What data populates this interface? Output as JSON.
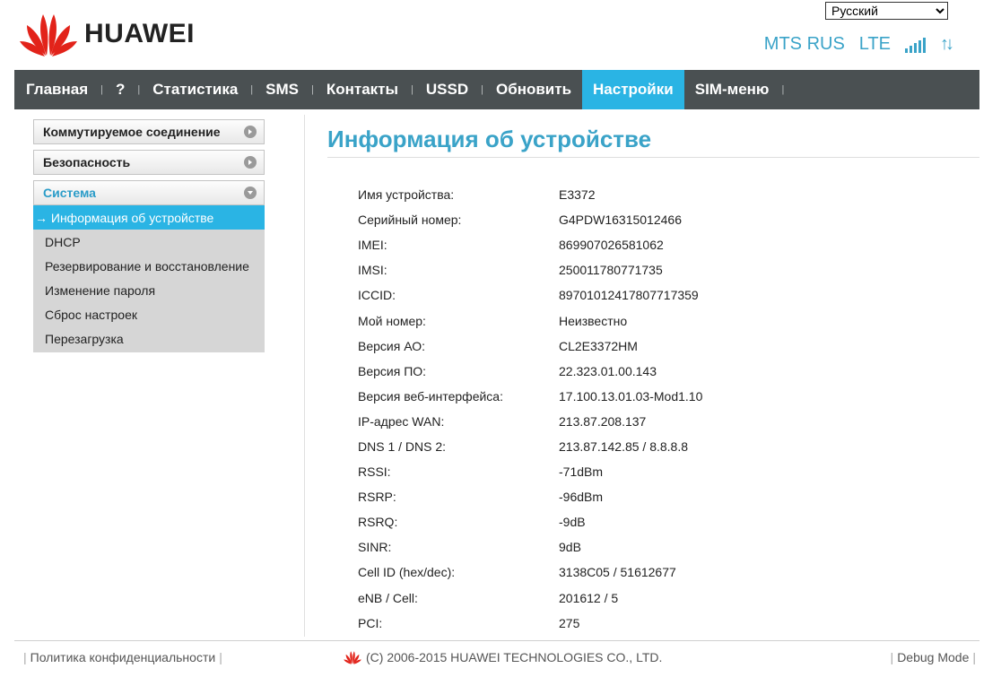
{
  "header": {
    "brand": "HUAWEI",
    "language": "Русский",
    "operator": "MTS RUS",
    "network": "LTE",
    "signal_bars": 5
  },
  "nav": {
    "items": [
      {
        "label": "Главная"
      },
      {
        "label": "?"
      },
      {
        "label": "Статистика"
      },
      {
        "label": "SMS"
      },
      {
        "label": "Контакты"
      },
      {
        "label": "USSD"
      },
      {
        "label": "Обновить"
      },
      {
        "label": "Настройки",
        "active": true
      },
      {
        "label": "SIM-меню"
      }
    ]
  },
  "sidebar": {
    "sections": [
      {
        "label": "Коммутируемое соединение"
      },
      {
        "label": "Безопасность"
      },
      {
        "label": "Система",
        "open": true
      }
    ],
    "items": [
      {
        "label": "→ Информация об устройстве",
        "active": true
      },
      {
        "label": "DHCP"
      },
      {
        "label": "Резервирование и восстановление"
      },
      {
        "label": "Изменение пароля"
      },
      {
        "label": "Сброс настроек"
      },
      {
        "label": "Перезагрузка"
      }
    ]
  },
  "main": {
    "title": "Информация об устройстве",
    "rows": [
      {
        "label": "Имя устройства:",
        "value": "E3372"
      },
      {
        "label": "Серийный номер:",
        "value": "G4PDW16315012466"
      },
      {
        "label": "IMEI:",
        "value": "869907026581062"
      },
      {
        "label": "IMSI:",
        "value": "250011780771735"
      },
      {
        "label": "ICCID:",
        "value": "89701012417807717359"
      },
      {
        "label": "Мой номер:",
        "value": "Неизвестно"
      },
      {
        "label": "Версия АО:",
        "value": "CL2E3372HM"
      },
      {
        "label": "Версия ПО:",
        "value": "22.323.01.00.143"
      },
      {
        "label": "Версия веб-интерфейса:",
        "value": "17.100.13.01.03-Mod1.10"
      },
      {
        "label": "IP-адрес WAN:",
        "value": "213.87.208.137"
      },
      {
        "label": "DNS 1 / DNS 2:",
        "value": "213.87.142.85 / 8.8.8.8"
      },
      {
        "label": "RSSI:",
        "value": "-71dBm"
      },
      {
        "label": "RSRP:",
        "value": "-96dBm"
      },
      {
        "label": "RSRQ:",
        "value": "-9dB"
      },
      {
        "label": "SINR:",
        "value": "9dB"
      },
      {
        "label": "Cell ID (hex/dec):",
        "value": "3138C05 / 51612677"
      },
      {
        "label": "eNB / Cell:",
        "value": "201612 / 5"
      },
      {
        "label": "PCI:",
        "value": "275"
      }
    ]
  },
  "footer": {
    "privacy": "Политика конфиденциальности",
    "copyright": "(C) 2006-2015 HUAWEI TECHNOLOGIES CO., LTD.",
    "debug": "Debug Mode"
  },
  "colors": {
    "accent": "#2ab4e4",
    "title": "#3aa3c8",
    "nav_bg": "#4a5052",
    "logo_red": "#e2231a"
  }
}
